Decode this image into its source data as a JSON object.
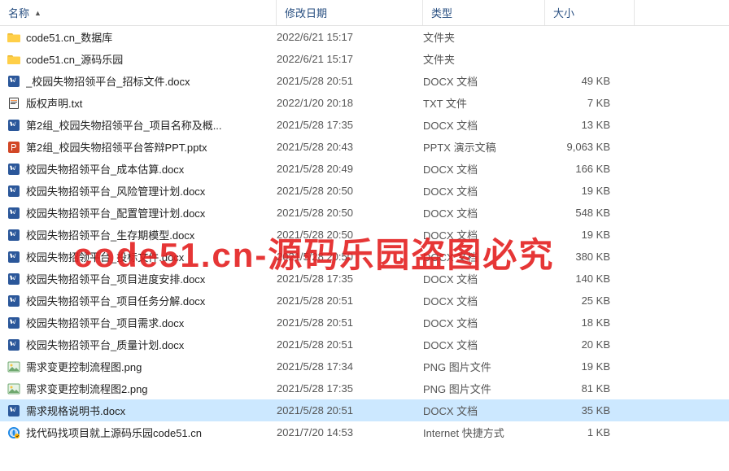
{
  "columns": {
    "name": "名称",
    "date": "修改日期",
    "type": "类型",
    "size": "大小"
  },
  "watermark": "code51.cn-源码乐园盗图必究",
  "files": [
    {
      "icon": "folder",
      "name": "code51.cn_数据库",
      "date": "2022/6/21 15:17",
      "type": "文件夹",
      "size": "",
      "selected": false
    },
    {
      "icon": "folder",
      "name": "code51.cn_源码乐园",
      "date": "2022/6/21 15:17",
      "type": "文件夹",
      "size": "",
      "selected": false
    },
    {
      "icon": "docx",
      "name": "_校园失物招领平台_招标文件.docx",
      "date": "2021/5/28 20:51",
      "type": "DOCX 文档",
      "size": "49 KB",
      "selected": false
    },
    {
      "icon": "txt",
      "name": "版权声明.txt",
      "date": "2022/1/20 20:18",
      "type": "TXT 文件",
      "size": "7 KB",
      "selected": false
    },
    {
      "icon": "docx",
      "name": "第2组_校园失物招领平台_项目名称及概...",
      "date": "2021/5/28 17:35",
      "type": "DOCX 文档",
      "size": "13 KB",
      "selected": false
    },
    {
      "icon": "pptx",
      "name": "第2组_校园失物招领平台答辩PPT.pptx",
      "date": "2021/5/28 20:43",
      "type": "PPTX 演示文稿",
      "size": "9,063 KB",
      "selected": false
    },
    {
      "icon": "docx",
      "name": "校园失物招领平台_成本估算.docx",
      "date": "2021/5/28 20:49",
      "type": "DOCX 文档",
      "size": "166 KB",
      "selected": false
    },
    {
      "icon": "docx",
      "name": "校园失物招领平台_风险管理计划.docx",
      "date": "2021/5/28 20:50",
      "type": "DOCX 文档",
      "size": "19 KB",
      "selected": false
    },
    {
      "icon": "docx",
      "name": "校园失物招领平台_配置管理计划.docx",
      "date": "2021/5/28 20:50",
      "type": "DOCX 文档",
      "size": "548 KB",
      "selected": false
    },
    {
      "icon": "docx",
      "name": "校园失物招领平台_生存期模型.docx",
      "date": "2021/5/28 20:50",
      "type": "DOCX 文档",
      "size": "19 KB",
      "selected": false
    },
    {
      "icon": "docx",
      "name": "校园失物招领平台_投标文件.docx",
      "date": "2021/5/28 20:50",
      "type": "DOCX 文档",
      "size": "380 KB",
      "selected": false
    },
    {
      "icon": "docx",
      "name": "校园失物招领平台_项目进度安排.docx",
      "date": "2021/5/28 17:35",
      "type": "DOCX 文档",
      "size": "140 KB",
      "selected": false
    },
    {
      "icon": "docx",
      "name": "校园失物招领平台_项目任务分解.docx",
      "date": "2021/5/28 20:51",
      "type": "DOCX 文档",
      "size": "25 KB",
      "selected": false
    },
    {
      "icon": "docx",
      "name": "校园失物招领平台_项目需求.docx",
      "date": "2021/5/28 20:51",
      "type": "DOCX 文档",
      "size": "18 KB",
      "selected": false
    },
    {
      "icon": "docx",
      "name": "校园失物招领平台_质量计划.docx",
      "date": "2021/5/28 20:51",
      "type": "DOCX 文档",
      "size": "20 KB",
      "selected": false
    },
    {
      "icon": "png",
      "name": "需求变更控制流程图.png",
      "date": "2021/5/28 17:34",
      "type": "PNG 图片文件",
      "size": "19 KB",
      "selected": false
    },
    {
      "icon": "png",
      "name": "需求变更控制流程图2.png",
      "date": "2021/5/28 17:35",
      "type": "PNG 图片文件",
      "size": "81 KB",
      "selected": false
    },
    {
      "icon": "docx",
      "name": "需求规格说明书.docx",
      "date": "2021/5/28 20:51",
      "type": "DOCX 文档",
      "size": "35 KB",
      "selected": true
    },
    {
      "icon": "url",
      "name": "找代码找项目就上源码乐园code51.cn",
      "date": "2021/7/20 14:53",
      "type": "Internet 快捷方式",
      "size": "1 KB",
      "selected": false
    }
  ]
}
